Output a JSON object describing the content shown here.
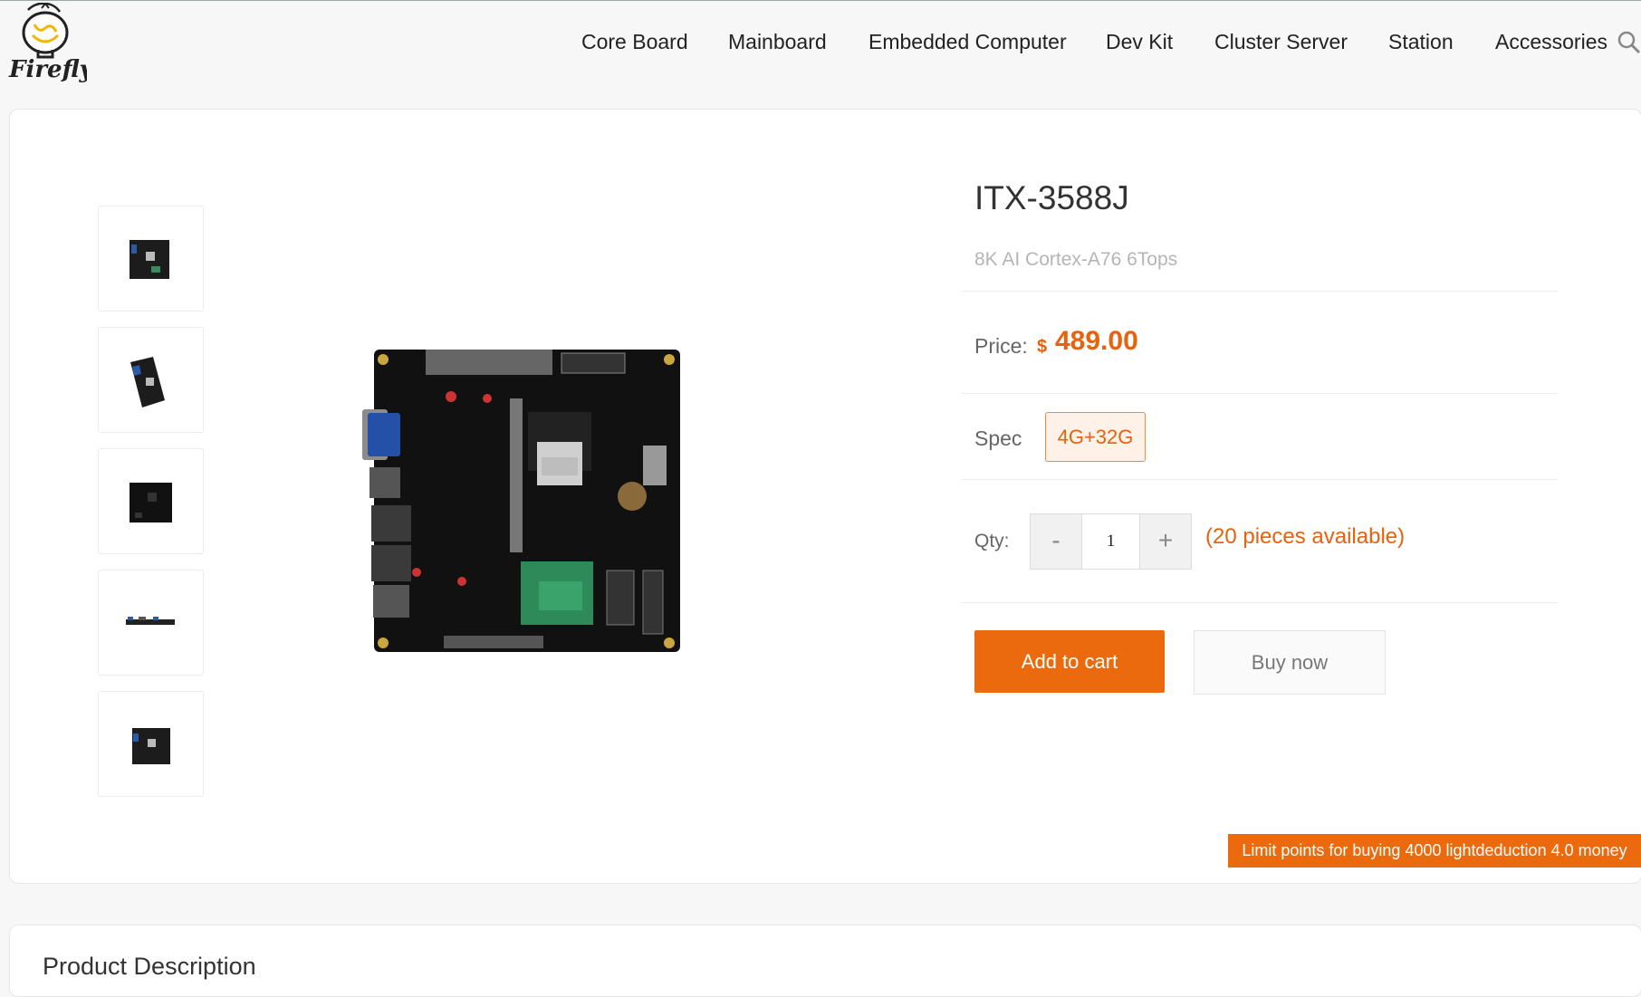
{
  "brand": {
    "logo_text": "Firefly",
    "logo_icon": "lightbulb-icon"
  },
  "nav": {
    "items": [
      "Core Board",
      "Mainboard",
      "Embedded Computer",
      "Dev Kit",
      "Cluster Server",
      "Station",
      "Accessories"
    ],
    "search_icon": "search-icon"
  },
  "gallery": {
    "thumbnails": [
      "board-top-view",
      "board-angled-view",
      "board-top-view-dark",
      "board-side-view",
      "board-top-view-small"
    ],
    "main_image": "itx-3588j-board"
  },
  "product": {
    "title": "ITX-3588J",
    "subtitle": "8K AI Cortex-A76 6Tops",
    "price_label": "Price:",
    "currency": "$",
    "price": "489.00",
    "spec_label": "Spec",
    "spec_option": "4G+32G",
    "qty_label": "Qty:",
    "qty_minus": "-",
    "qty_value": "1",
    "qty_plus": "+",
    "availability": "(20 pieces available)",
    "add_to_cart": "Add to cart",
    "buy_now": "Buy now",
    "promo": "Limit points for buying 4000 lightdeduction 4.0 money"
  },
  "description": {
    "title": "Product Description"
  },
  "colors": {
    "accent": "#ec6a0e",
    "accent_text": "#e8620e",
    "muted": "#b5b5b5"
  }
}
